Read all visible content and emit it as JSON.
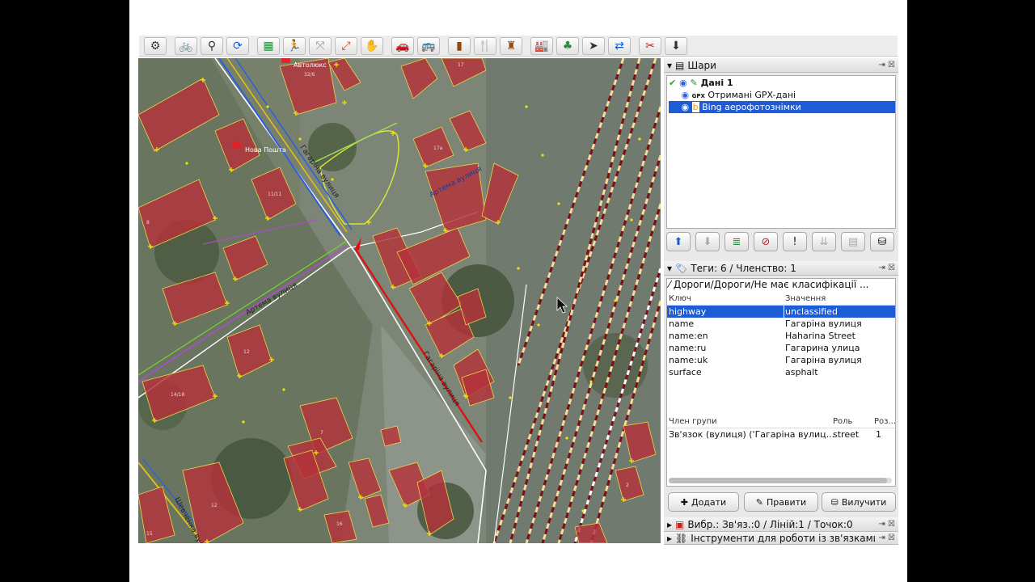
{
  "toolbar": {
    "icons": [
      "preferences-icon",
      "bicycle-icon",
      "bicycle-icon",
      "refresh-icon",
      "map-icon",
      "walk-icon",
      "walk-icon",
      "walk-icon",
      "hand-icon",
      "car-icon",
      "bus-icon",
      "sign-icon",
      "food-icon",
      "castle-icon",
      "factory-icon",
      "tree-icon",
      "cursor-icon",
      "arrow-icon",
      "scissors-icon",
      "download-icon"
    ]
  },
  "map": {
    "labels": {
      "nova_poshta": "Нова Пошта",
      "avtoluks": "Автолюкс",
      "gagarina_1": "Гагаріна вулиця",
      "gagarina_2": "Гагаріна вулиця",
      "artema_1": "Артема вулиця",
      "artema_2": "Артема вулиця",
      "shevchenka": "Шевченка вулиця"
    },
    "house_numbers": [
      "32/6",
      "17",
      "17а",
      "11/11",
      "8",
      "12",
      "14/18",
      "7",
      "12",
      "15",
      "16",
      "2"
    ]
  },
  "layers": {
    "title": "Шари",
    "items": [
      {
        "label": "Дані 1",
        "badge": "",
        "selected": false
      },
      {
        "label": "Отримані GPX-дані",
        "badge": "GPX",
        "selected": false
      },
      {
        "label": "Bing аерофотознімки",
        "badge": "",
        "selected": true
      }
    ],
    "buttons": [
      "move-up-icon",
      "move-down-icon",
      "merge-icon",
      "delete-layer-icon",
      "alert-icon",
      "layers-icon",
      "stack-icon",
      "database-icon"
    ]
  },
  "tags": {
    "title": "Теги: 6 / Членство: 1",
    "object_title": "Дороги/Дороги/Не має класифікації ...",
    "col_key": "Ключ",
    "col_value": "Значення",
    "rows": [
      {
        "key": "highway",
        "value": "unclassified",
        "selected": true
      },
      {
        "key": "name",
        "value": "Гагаріна вулиця",
        "selected": false
      },
      {
        "key": "name:en",
        "value": "Haharina Street",
        "selected": false
      },
      {
        "key": "name:ru",
        "value": "Гагарина улица",
        "selected": false
      },
      {
        "key": "name:uk",
        "value": "Гагаріна вулиця",
        "selected": false
      },
      {
        "key": "surface",
        "value": "asphalt",
        "selected": false
      }
    ],
    "membership": {
      "col_member": "Член групи",
      "col_role": "Роль",
      "col_pos": "Роз...",
      "rows": [
        {
          "member": "Зв'язок (вулиця) ('Гагаріна вулиц...",
          "role": "street",
          "pos": "1"
        }
      ]
    },
    "btn_add": "Додати",
    "btn_edit": "Правити",
    "btn_delete": "Вилучити"
  },
  "selection": {
    "title": "Вибр.: Зв'яз.:0 / Ліній:1 / Точок:0"
  },
  "relations": {
    "title": "Інструменти для роботи із зв'язками"
  },
  "colors": {
    "selection_blue": "#1e5bd6",
    "building_fill": "#b4323a",
    "road_selected": "#e01010",
    "node_yellow": "#f2e600"
  }
}
